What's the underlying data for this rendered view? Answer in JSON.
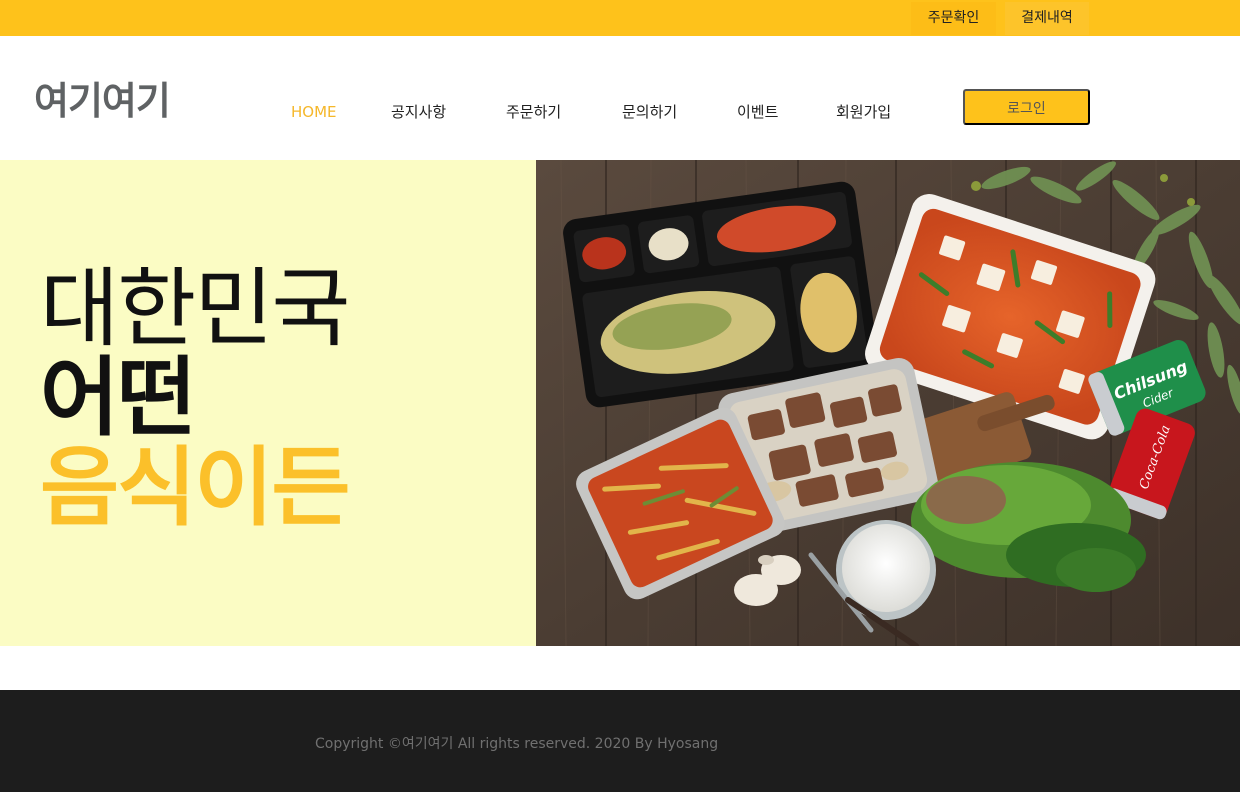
{
  "topbar": {
    "order_check": "주문확인",
    "payment_history": "결제내역"
  },
  "header": {
    "logo": "여기여기",
    "nav": [
      {
        "label": "HOME",
        "active": true
      },
      {
        "label": "공지사항",
        "active": false
      },
      {
        "label": "주문하기",
        "active": false
      },
      {
        "label": "문의하기",
        "active": false
      },
      {
        "label": "이벤트",
        "active": false
      },
      {
        "label": "회원가입",
        "active": false
      }
    ],
    "login": "로그인"
  },
  "hero": {
    "line1": "대한민국",
    "line2": "어떤",
    "line3": "음식이든",
    "image": {
      "cider_label_1": "Chilsung",
      "cider_label_2": "Cider",
      "cola_label": "Coca-Cola"
    }
  },
  "footer": {
    "copyright": "Copyright ©여기여기 All rights reserved. 2020 By Hyosang"
  },
  "colors": {
    "accent": "#fec21b",
    "hero_bg": "#fbfcc4",
    "footer_bg": "#1d1d1d",
    "highlight_text": "#fbc02a"
  }
}
